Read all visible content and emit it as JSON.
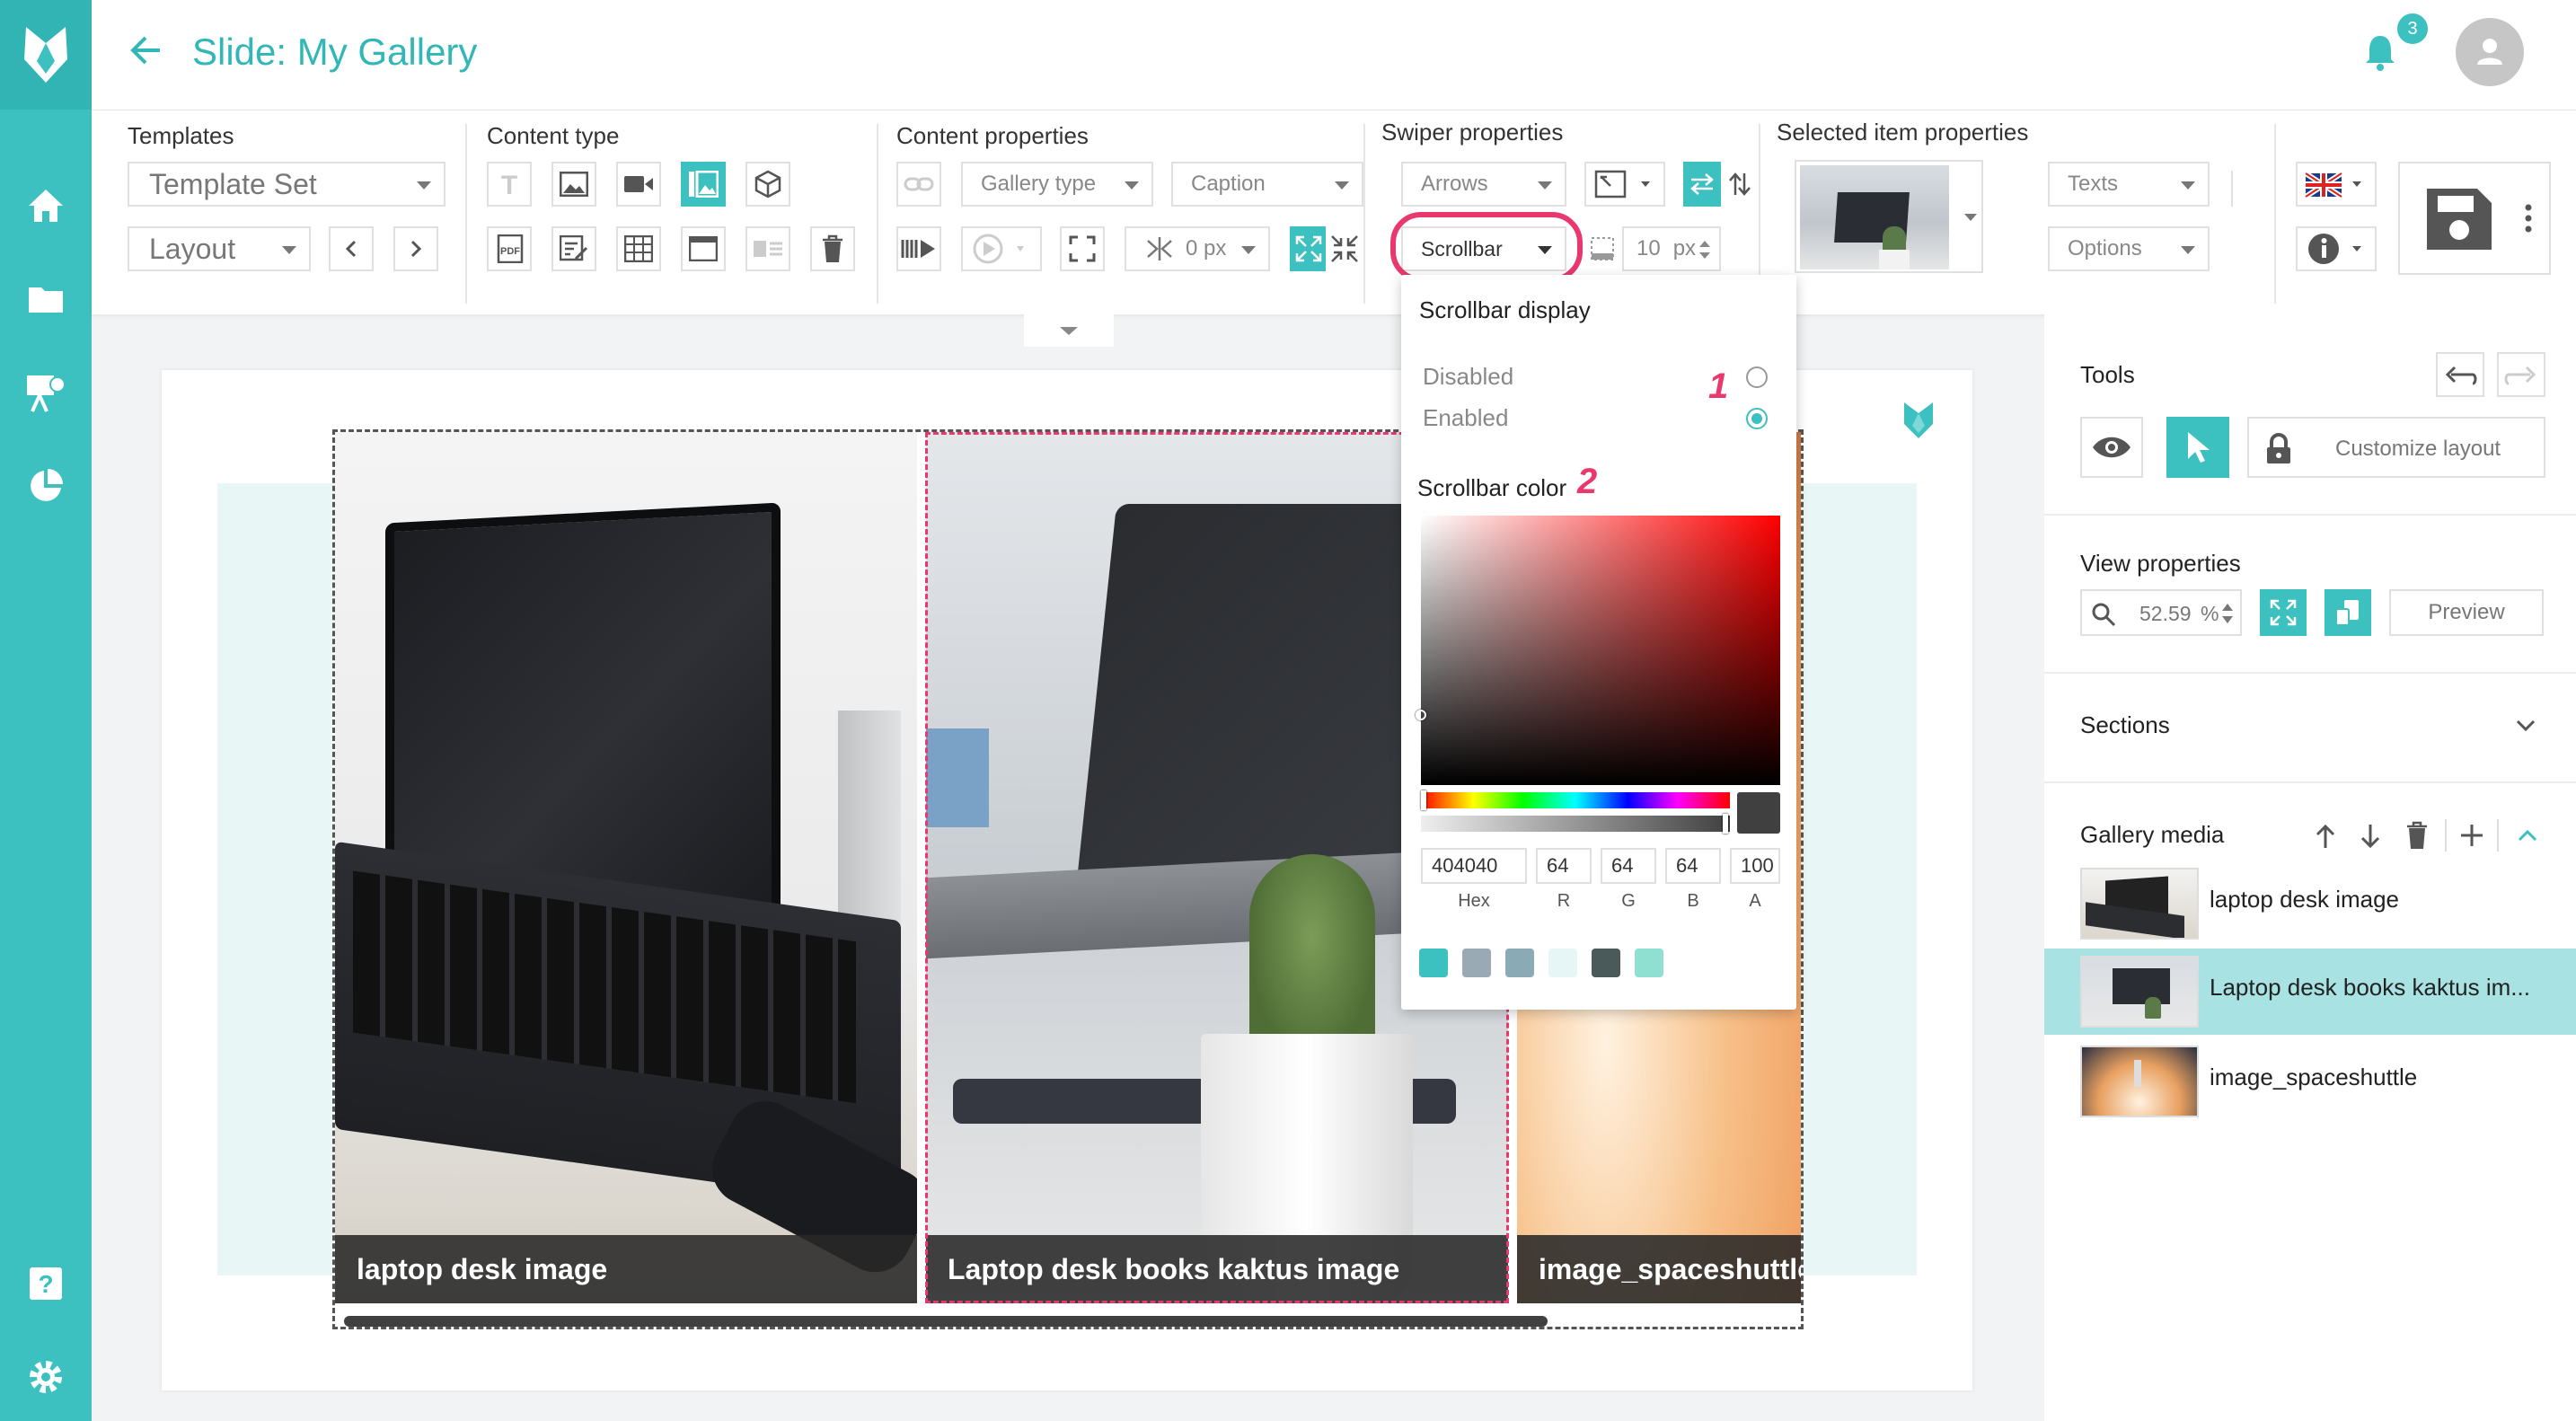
{
  "header": {
    "title": "Slide: My Gallery",
    "notification_count": "3"
  },
  "ribbon": {
    "templates": {
      "label": "Templates",
      "template_set": "Template Set",
      "layout": "Layout"
    },
    "content_type": {
      "label": "Content type"
    },
    "content_properties": {
      "label": "Content properties",
      "gallery_type": "Gallery type",
      "caption": "Caption",
      "spacing": "0 px"
    },
    "swiper_properties": {
      "label": "Swiper properties",
      "arrows": "Arrows",
      "scrollbar": "Scrollbar",
      "scrollbar_size": "10",
      "scrollbar_unit": "px"
    },
    "selected_item_properties": {
      "label": "Selected item properties",
      "texts": "Texts",
      "options": "Options"
    }
  },
  "scrollbar_popup": {
    "display_title": "Scrollbar display",
    "disabled": "Disabled",
    "enabled": "Enabled",
    "marker_1": "1",
    "color_title": "Scrollbar color",
    "marker_2": "2",
    "hex": "404040",
    "r": "64",
    "g": "64",
    "b": "64",
    "a": "100",
    "labels": {
      "hex": "Hex",
      "r": "R",
      "g": "G",
      "b": "B",
      "a": "A"
    },
    "swatches": [
      "#3cc0c0",
      "#9aaab4",
      "#8aaab6",
      "#e6f6f6",
      "#4a5a5a",
      "#8fe0d0"
    ]
  },
  "gallery": {
    "slides": [
      {
        "caption": "laptop desk image"
      },
      {
        "caption": "Laptop desk books kaktus image"
      },
      {
        "caption": "image_spaceshuttle"
      }
    ]
  },
  "right_panel": {
    "tools": {
      "title": "Tools",
      "customize": "Customize layout"
    },
    "view": {
      "title": "View properties",
      "zoom": "52.59",
      "zoom_unit": "%",
      "preview": "Preview"
    },
    "sections": {
      "title": "Sections"
    },
    "media": {
      "title": "Gallery media",
      "items": [
        {
          "label": "laptop desk image"
        },
        {
          "label": "Laptop desk books kaktus im..."
        },
        {
          "label": "image_spaceshuttle"
        }
      ]
    }
  },
  "colors": {
    "accent": "#3cc0c0",
    "highlight": "#e8386e"
  }
}
